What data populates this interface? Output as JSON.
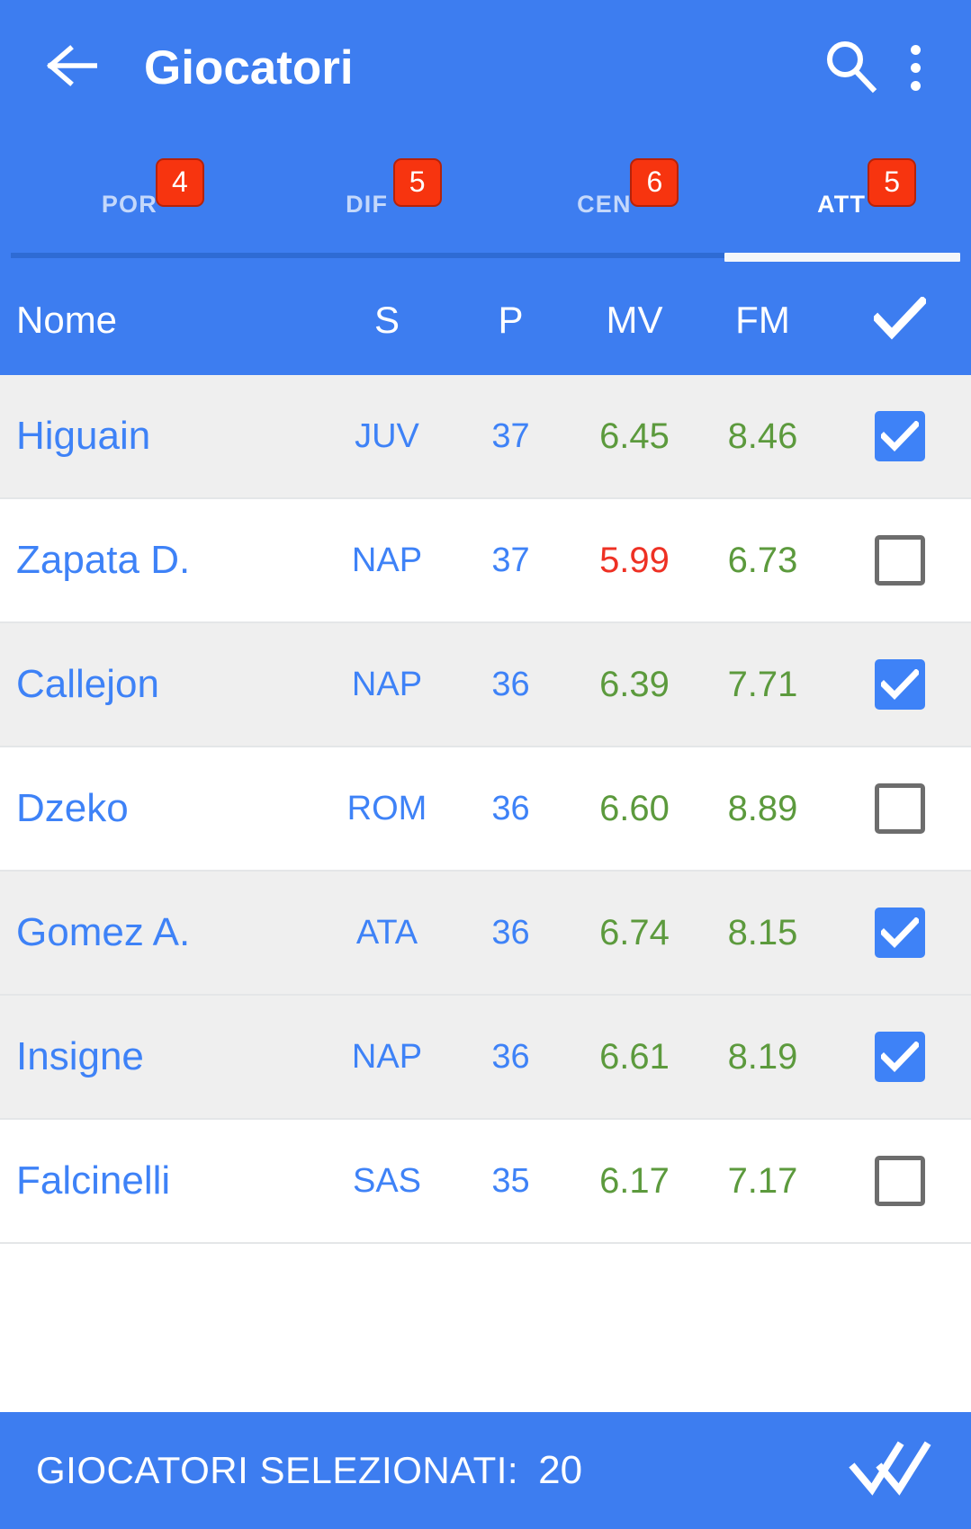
{
  "appbar": {
    "back_icon": "arrow-left-icon",
    "title": "Giocatori",
    "search_icon": "search-icon",
    "overflow_icon": "more-vertical-icon"
  },
  "tabs": [
    {
      "label": "POR",
      "badge": "4",
      "active": false
    },
    {
      "label": "DIF",
      "badge": "5",
      "active": false
    },
    {
      "label": "CEN",
      "badge": "6",
      "active": false
    },
    {
      "label": "ATT",
      "badge": "5",
      "active": true
    }
  ],
  "columns": {
    "name": "Nome",
    "s": "S",
    "p": "P",
    "mv": "MV",
    "fm": "FM",
    "check_icon": "check-icon"
  },
  "players": [
    {
      "name": "Higuain",
      "team": "JUV",
      "p": "37",
      "mv": "6.45",
      "fm": "8.46",
      "mv_state": "green",
      "fm_state": "green",
      "checked": true,
      "shaded": true
    },
    {
      "name": "Zapata D.",
      "team": "NAP",
      "p": "37",
      "mv": "5.99",
      "fm": "6.73",
      "mv_state": "red",
      "fm_state": "green",
      "checked": false,
      "shaded": false
    },
    {
      "name": "Callejon",
      "team": "NAP",
      "p": "36",
      "mv": "6.39",
      "fm": "7.71",
      "mv_state": "green",
      "fm_state": "green",
      "checked": true,
      "shaded": true
    },
    {
      "name": "Dzeko",
      "team": "ROM",
      "p": "36",
      "mv": "6.60",
      "fm": "8.89",
      "mv_state": "green",
      "fm_state": "green",
      "checked": false,
      "shaded": false
    },
    {
      "name": "Gomez A.",
      "team": "ATA",
      "p": "36",
      "mv": "6.74",
      "fm": "8.15",
      "mv_state": "green",
      "fm_state": "green",
      "checked": true,
      "shaded": true
    },
    {
      "name": "Insigne",
      "team": "NAP",
      "p": "36",
      "mv": "6.61",
      "fm": "8.19",
      "mv_state": "green",
      "fm_state": "green",
      "checked": true,
      "shaded": true
    },
    {
      "name": "Falcinelli",
      "team": "SAS",
      "p": "35",
      "mv": "6.17",
      "fm": "7.17",
      "mv_state": "green",
      "fm_state": "green",
      "checked": false,
      "shaded": false
    }
  ],
  "bottombar": {
    "label": "GIOCATORI SELEZIONATI:",
    "count": "20",
    "confirm_icon": "double-check-icon"
  },
  "colors": {
    "primary_blue": "#3D7DF0",
    "badge_red": "#F7340F",
    "value_green": "#5C9A3D",
    "value_red": "#EE3124",
    "link_blue": "#3E82F7",
    "row_shaded": "#EFEFEF"
  }
}
